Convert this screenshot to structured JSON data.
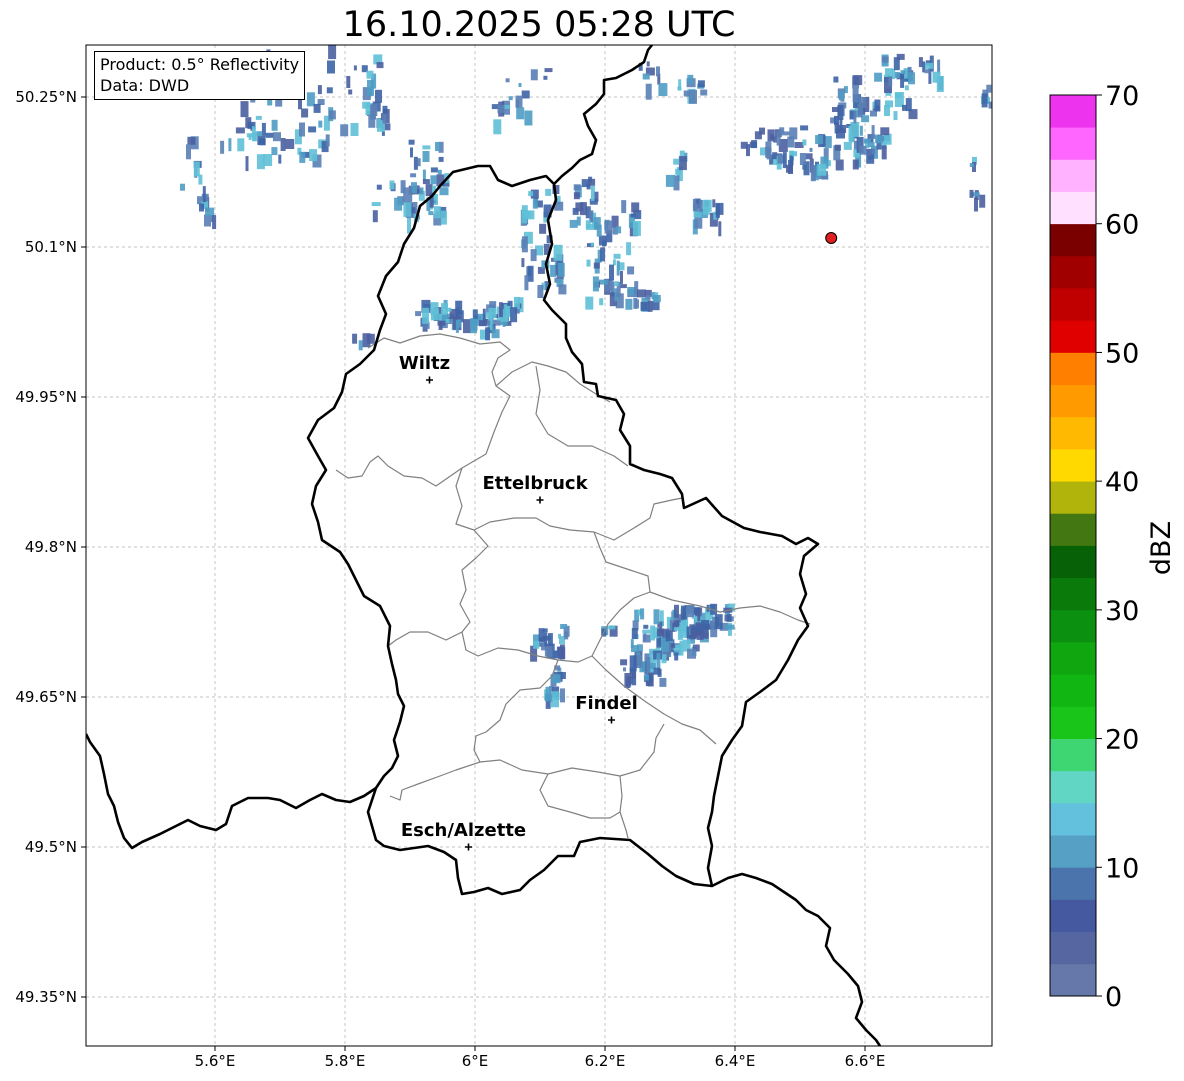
{
  "title": "16.10.2025 05:28 UTC",
  "info": {
    "product": "Product: 0.5° Reflectivity",
    "data": "Data: DWD"
  },
  "map": {
    "extent": {
      "lon_min": 5.4,
      "lon_max": 6.795,
      "lat_min": 49.3,
      "lat_max": 50.3
    },
    "lat_ticks": [
      {
        "value": 50.25,
        "label": "50.25°N"
      },
      {
        "value": 50.1,
        "label": "50.1°N"
      },
      {
        "value": 49.95,
        "label": "49.95°N"
      },
      {
        "value": 49.8,
        "label": "49.8°N"
      },
      {
        "value": 49.65,
        "label": "49.65°N"
      },
      {
        "value": 49.5,
        "label": "49.5°N"
      },
      {
        "value": 49.35,
        "label": "49.35°N"
      }
    ],
    "lon_ticks": [
      {
        "value": 5.6,
        "label": "5.6°E"
      },
      {
        "value": 5.8,
        "label": "5.8°E"
      },
      {
        "value": 6.0,
        "label": "6°E"
      },
      {
        "value": 6.2,
        "label": "6.2°E"
      },
      {
        "value": 6.4,
        "label": "6.4°E"
      },
      {
        "value": 6.6,
        "label": "6.6°E"
      }
    ],
    "cities": [
      {
        "name": "Wiltz",
        "lon": 5.93,
        "lat": 49.967
      },
      {
        "name": "Ettelbruck",
        "lon": 6.1,
        "lat": 49.847
      },
      {
        "name": "Findel",
        "lon": 6.21,
        "lat": 49.627
      },
      {
        "name": "Esch/Alzette",
        "lon": 5.99,
        "lat": 49.5
      }
    ],
    "radar_site": {
      "lon": 6.548,
      "lat": 50.109,
      "color": "#e02020"
    },
    "border_color": "#000000",
    "canton_color": "#808080"
  },
  "colorbar": {
    "label": "dBZ",
    "min": 0,
    "max": 70,
    "ticks": [
      0,
      10,
      20,
      30,
      40,
      50,
      60,
      70
    ],
    "colors": [
      "#6677aa",
      "#5566a0",
      "#44599f",
      "#4a74ab",
      "#56a0c6",
      "#63c1dd",
      "#62d6c4",
      "#3ed672",
      "#18c518",
      "#12b612",
      "#10a610",
      "#0c9010",
      "#0a7a0a",
      "#076107",
      "#437711",
      "#b1b40a",
      "#ffd900",
      "#ffb900",
      "#ff9a00",
      "#ff7f00",
      "#e00000",
      "#c00000",
      "#a00000",
      "#7a0000",
      "#ffe0ff",
      "#ffb2ff",
      "#ff66ff",
      "#ee33ee"
    ]
  },
  "echo_colors": [
    "#4a5fa0",
    "#3d64a6",
    "#5a7fb5",
    "#4e9cc4",
    "#5fc0d6"
  ]
}
